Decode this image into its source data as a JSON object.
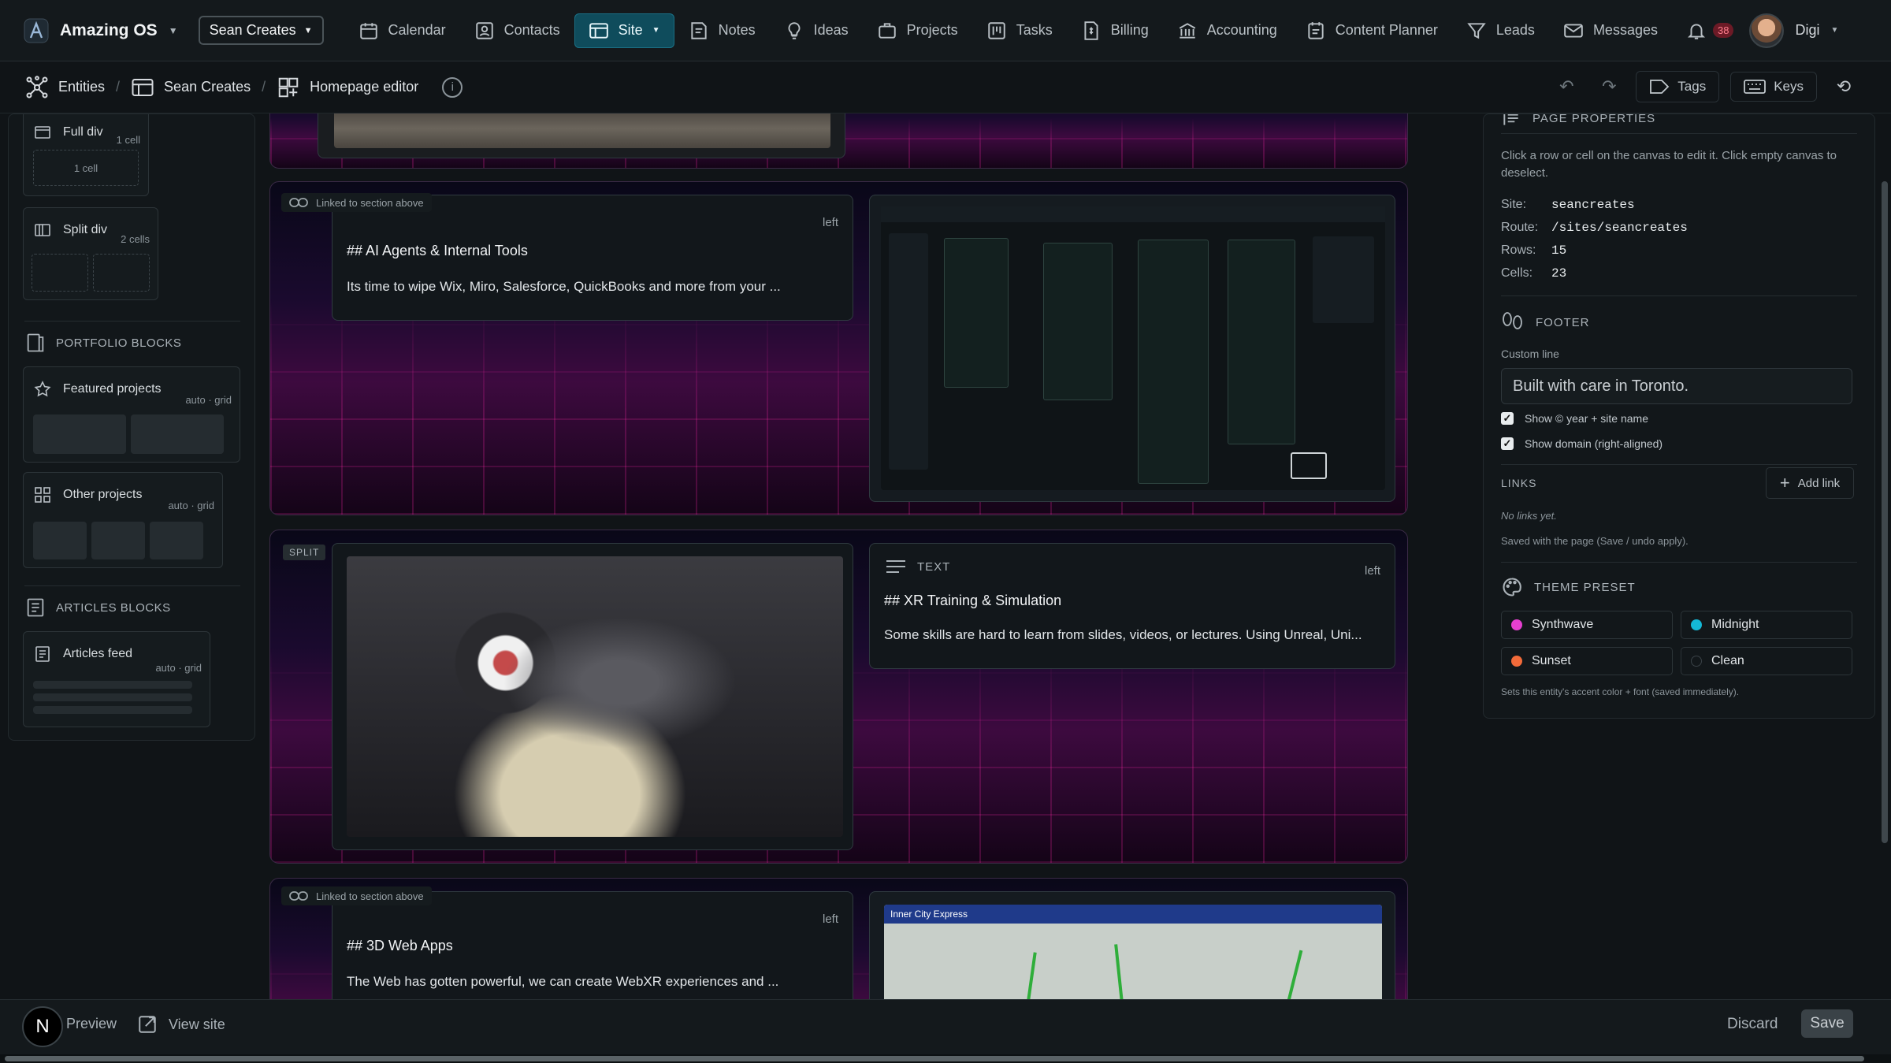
{
  "app": {
    "name": "Amazing OS",
    "workspace": "Sean Creates"
  },
  "nav": [
    {
      "label": "Calendar",
      "icon": "calendar-icon"
    },
    {
      "label": "Contacts",
      "icon": "contacts-icon"
    },
    {
      "label": "Site",
      "icon": "site-icon",
      "active": true
    },
    {
      "label": "Notes",
      "icon": "notes-icon"
    },
    {
      "label": "Ideas",
      "icon": "lightbulb-icon"
    },
    {
      "label": "Projects",
      "icon": "briefcase-icon"
    },
    {
      "label": "Tasks",
      "icon": "tasks-icon"
    },
    {
      "label": "Billing",
      "icon": "billing-icon"
    },
    {
      "label": "Accounting",
      "icon": "bank-icon"
    },
    {
      "label": "Content Planner",
      "icon": "planner-icon"
    },
    {
      "label": "Leads",
      "icon": "filter-icon"
    },
    {
      "label": "Messages",
      "icon": "mail-icon"
    }
  ],
  "notifications": {
    "count": "38"
  },
  "user": {
    "name": "Digi"
  },
  "breadcrumb": {
    "entities": "Entities",
    "site": "Sean Creates",
    "page": "Homepage editor"
  },
  "toolbar": {
    "tags": "Tags",
    "keys": "Keys"
  },
  "left_panel": {
    "full_div": {
      "title": "Full div",
      "meta": "1 cell",
      "cell": "1 cell"
    },
    "split_div": {
      "title": "Split div",
      "meta": "2 cells"
    },
    "portfolio_heading": "PORTFOLIO BLOCKS",
    "featured": {
      "title": "Featured projects",
      "meta": "auto · grid"
    },
    "other": {
      "title": "Other projects",
      "meta": "auto · grid"
    },
    "articles_heading": "ARTICLES BLOCKS",
    "articles": {
      "title": "Articles feed",
      "meta": "auto · grid"
    }
  },
  "canvas": {
    "row2": {
      "linked": "Linked to section above",
      "type": "TEXT",
      "align": "left",
      "heading": "## AI Agents & Internal Tools",
      "body": "Its time to wipe Wix, Miro, Salesforce, QuickBooks and more from your ..."
    },
    "row3": {
      "pill": "SPLIT",
      "type": "TEXT",
      "align": "left",
      "heading": "## XR Training & Simulation",
      "body": "Some skills are hard to learn from slides, videos, or lectures. Using Unreal, Uni..."
    },
    "row4": {
      "linked": "Linked to section above",
      "type": "TEXT",
      "align": "left",
      "heading": "## 3D Web Apps",
      "body": "The Web has gotten powerful, we can create WebXR experiences and ...",
      "map_title": "Inner City Express"
    }
  },
  "right_panel": {
    "heading": "PAGE PROPERTIES",
    "hint": "Click a row or cell on the canvas to edit it. Click empty canvas to deselect.",
    "site_label": "Site:",
    "site": "seancreates",
    "route_label": "Route:",
    "route": "/sites/seancreates",
    "rows_label": "Rows:",
    "rows": "15",
    "cells_label": "Cells:",
    "cells": "23",
    "footer_heading": "FOOTER",
    "custom_line_label": "Custom line",
    "custom_line_value": "Built with care in Toronto.",
    "show_year": "Show © year + site name",
    "show_domain": "Show domain (right-aligned)",
    "links_heading": "LINKS",
    "add_link": "Add link",
    "no_links": "No links yet.",
    "saved_note": "Saved with the page (Save / undo apply).",
    "theme_heading": "THEME PRESET",
    "themes": [
      {
        "name": "Synthwave",
        "color": "#e63fd0"
      },
      {
        "name": "Midnight",
        "color": "#14b8d6"
      },
      {
        "name": "Sunset",
        "color": "#f26b3a"
      },
      {
        "name": "Clean",
        "color": "#2a3034"
      }
    ],
    "theme_note": "Sets this entity's accent color + font (saved immediately)."
  },
  "bottom": {
    "preview": "Preview",
    "view_site": "View site",
    "discard": "Discard",
    "save": "Save",
    "fab": "N"
  }
}
